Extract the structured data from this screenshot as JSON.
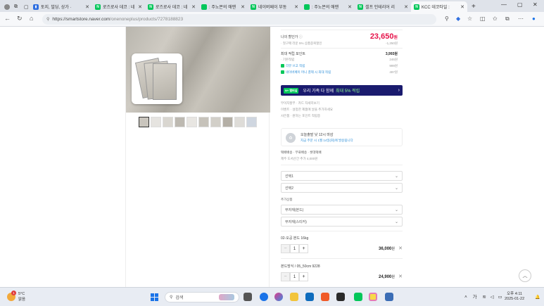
{
  "browser": {
    "tabs": [
      {
        "label": "토지, 빌딩, 상가 ·",
        "favicon_color": "#2f6fe0",
        "favicon_glyph": "▮"
      },
      {
        "label": "로즈로사 데코 : 네",
        "favicon_color": "#03c75a",
        "favicon_glyph": "N"
      },
      {
        "label": "로즈로사 데코 : 네",
        "favicon_color": "#03c75a",
        "favicon_glyph": "N"
      },
      {
        "label": ": 주노몬의 애맨",
        "favicon_color": "#03c75a",
        "favicon_glyph": "blog"
      },
      {
        "label": "네이버페이 부동",
        "favicon_color": "#03c75a",
        "favicon_glyph": "N"
      },
      {
        "label": ": 주노몬의 애맨",
        "favicon_color": "#03c75a",
        "favicon_glyph": "blog"
      },
      {
        "label": "셀프 인테리어 리",
        "favicon_color": "#03c75a",
        "favicon_glyph": "N"
      },
      {
        "label": "KCC 데코타일 :",
        "favicon_color": "#03c75a",
        "favicon_glyph": "N",
        "active": true
      }
    ],
    "new_tab_label": "+",
    "url_host": "https://smartstore.naver.com",
    "url_path": "/onenoneplus/products/7278188823"
  },
  "product": {
    "thumbnail_colors": [
      "#c9c5bd",
      "#e6e4e0",
      "#d9d6d0",
      "#bdb9b1",
      "#e8e6e2",
      "#c6c2ba",
      "#d2cfc8",
      "#b4afa6",
      "#dedcd8",
      "#cfd6e0"
    ]
  },
  "pricing": {
    "my_price_label": "나의 할인가",
    "my_price_value": "23,650",
    "my_price_unit": "원",
    "cond_text": "· 첫구매 라운 5% 상품중복할인",
    "cond_value": "-1,250원",
    "max_points_label": "최대 적립 포인트",
    "max_points_value": "3,993원",
    "basic_label": "· 기본적립",
    "basic_value": "246원",
    "review_label": "리뷰 쓰고 적립",
    "review_value": "999원",
    "naverpay_label": "네이버페이 머니 결제 시 최대 적립",
    "naverpay_value": "497원",
    "banner_badge": "N+ 멤버십",
    "banner_text": "우리 가족 다 함께",
    "banner_highlight": "최대 5% 적립",
    "banner_arrow": "›"
  },
  "info": {
    "card_label": "무이자할부",
    "card_value": "카드 자세히보기",
    "event_label": "이벤트",
    "event_value": "설정한 제품에 날을 추가하세요",
    "support_label": "사은품",
    "support_value": "원하는 포인트 적립중"
  },
  "benefit": {
    "icon": "♻",
    "line1": "오늘출발 낮 12시 마감",
    "line2": "지금 주문 시 1월 14일(화)에 발송됩니다"
  },
  "delivery": {
    "line1_label": "택배배송",
    "line1_value": "무료배송 · 롯데택배",
    "line2": "제주 도서산간 추가 4,000원"
  },
  "options": {
    "select1": "선택1",
    "select2": "선택2",
    "addon_label": "추가상품",
    "addon1": "부자재(본드)",
    "addon2": "부자재(스티커)"
  },
  "cart": [
    {
      "name": "02-오공 본드 16kg",
      "qty": "1",
      "amount": "36,000",
      "unit": "원"
    },
    {
      "name": "본드방식 / 05_50cm 9228",
      "qty": "1",
      "amount": "24,900",
      "unit": "원"
    }
  ],
  "taskbar": {
    "weather_temp": "5°C",
    "weather_desc": "맑음",
    "weather_badge": "1",
    "search_placeholder": "검색",
    "tray": "가",
    "time": "오후 4:11",
    "date": "2025-01-22"
  }
}
